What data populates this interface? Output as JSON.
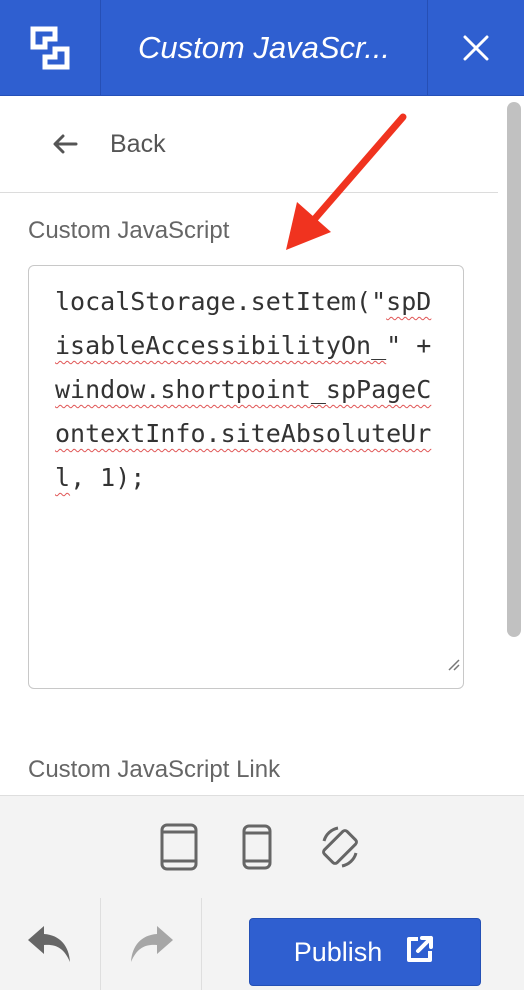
{
  "header": {
    "title": "Custom JavaScr...",
    "logo_icon": "shortpoint-logo-icon",
    "close_icon": "close-icon",
    "background": "#2f5fd0"
  },
  "nav": {
    "back_label": "Back",
    "back_icon": "arrow-left-icon"
  },
  "custom_js": {
    "label": "Custom JavaScript",
    "code_parts": [
      "localStorage.setItem(\"",
      "spDisableAccessibilityOn_",
      "\" + ",
      "window.shortpoint_spPageContextInfo.siteAbsoluteUrl",
      ", 1);"
    ]
  },
  "custom_js_link": {
    "label": "Custom JavaScript Link"
  },
  "device_bar": {
    "icons": [
      "tablet-icon",
      "phone-icon",
      "rotate-device-icon"
    ]
  },
  "footer": {
    "undo_icon": "undo-icon",
    "redo_icon": "redo-icon",
    "publish_label": "Publish",
    "publish_icon": "external-link-icon",
    "accent": "#2f5fd0"
  },
  "annotation": {
    "color": "#f0331f",
    "icon": "red-arrow-annotation"
  }
}
